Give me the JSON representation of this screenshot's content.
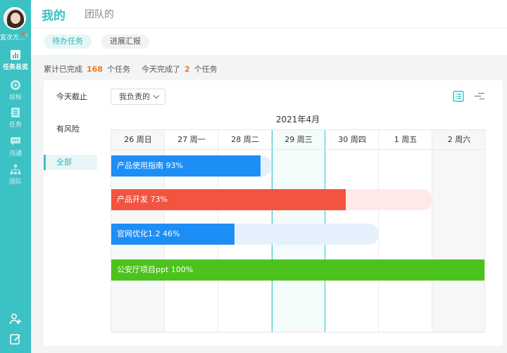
{
  "user": {
    "name": "宜次方..."
  },
  "nav": [
    {
      "label": "任务总览",
      "icon": "bar-chart-icon",
      "active": true
    },
    {
      "label": "目标",
      "icon": "target-icon",
      "active": false
    },
    {
      "label": "任务",
      "icon": "list-icon",
      "active": false
    },
    {
      "label": "沟通",
      "icon": "chat-icon",
      "active": false
    },
    {
      "label": "团队",
      "icon": "team-icon",
      "active": false
    }
  ],
  "top_tabs": [
    "我的",
    "团队的"
  ],
  "sub_tabs": [
    "待办任务",
    "进展汇报"
  ],
  "stats": {
    "total_prefix": "累计已完成",
    "total_count": "168",
    "total_suffix": "个任务",
    "today_prefix": "今天完成了",
    "today_count": "2",
    "today_suffix": "个任务"
  },
  "filters": [
    "今天截止",
    "有风险",
    "全部"
  ],
  "dropdown": {
    "value": "我负责的"
  },
  "calendar": {
    "month": "2021年4月",
    "days": [
      "26 周日",
      "27 周一",
      "28 周二",
      "29 周三",
      "30 周四",
      "1 周五",
      "2 周六"
    ]
  },
  "tasks": [
    {
      "label": "产品使用指南",
      "percent_text": "93%",
      "progress": 0.93,
      "color": "#1d8ef5",
      "track": "#e4f1fd",
      "start_day": 0,
      "end_day": 3.0
    },
    {
      "label": "产品开发",
      "percent_text": "73%",
      "progress": 0.73,
      "color": "#f25440",
      "track": "#fdeae7",
      "start_day": 0,
      "end_day": 6.0
    },
    {
      "label": "官网优化1.2",
      "percent_text": "46%",
      "progress": 0.46,
      "color": "#1d8ef5",
      "track": "#e4f1fd",
      "start_day": 0,
      "end_day": 5.0
    },
    {
      "label": "公安厅项目ppt",
      "percent_text": "100%",
      "progress": 1.0,
      "color": "#4cc31d",
      "track": "#dcf2d2",
      "start_day": 0,
      "end_day": 7.0
    }
  ],
  "colors": {
    "accent": "#3cc1c4",
    "orange": "#f07b1c"
  }
}
